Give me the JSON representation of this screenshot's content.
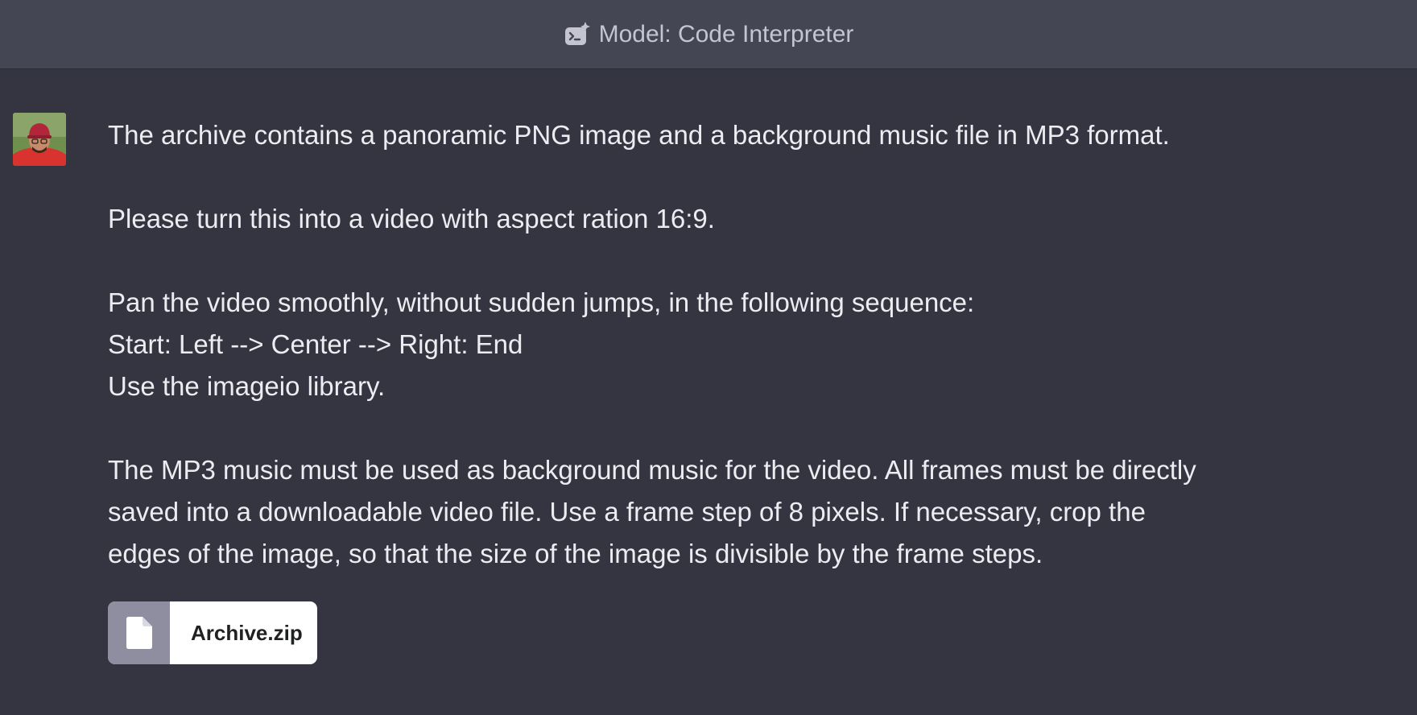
{
  "header": {
    "model_label": "Model: Code Interpreter",
    "icon": "code-interpreter-icon"
  },
  "message": {
    "avatar": "user-avatar",
    "paragraphs": [
      [
        "The archive contains a panoramic PNG image and a background music file in MP3 format."
      ],
      [
        "Please turn this into a video with aspect ration 16:9."
      ],
      [
        "Pan the video smoothly, without sudden jumps, in the following sequence:",
        "Start: Left --> Center --> Right: End",
        "Use the imageio library."
      ],
      [
        "The MP3 music must be used as background music for the video. All frames must be directly",
        "saved into a downloadable video file. Use a frame step of 8 pixels. If necessary, crop the",
        "edges of the image, so that the size of the image is divisible by the frame steps."
      ]
    ]
  },
  "attachment": {
    "filename": "Archive.zip",
    "icon": "file-icon"
  },
  "colors": {
    "background": "#343541",
    "header_bg": "#444654",
    "text": "#ececf1",
    "attachment_icon_bg": "#8e8ea0"
  }
}
